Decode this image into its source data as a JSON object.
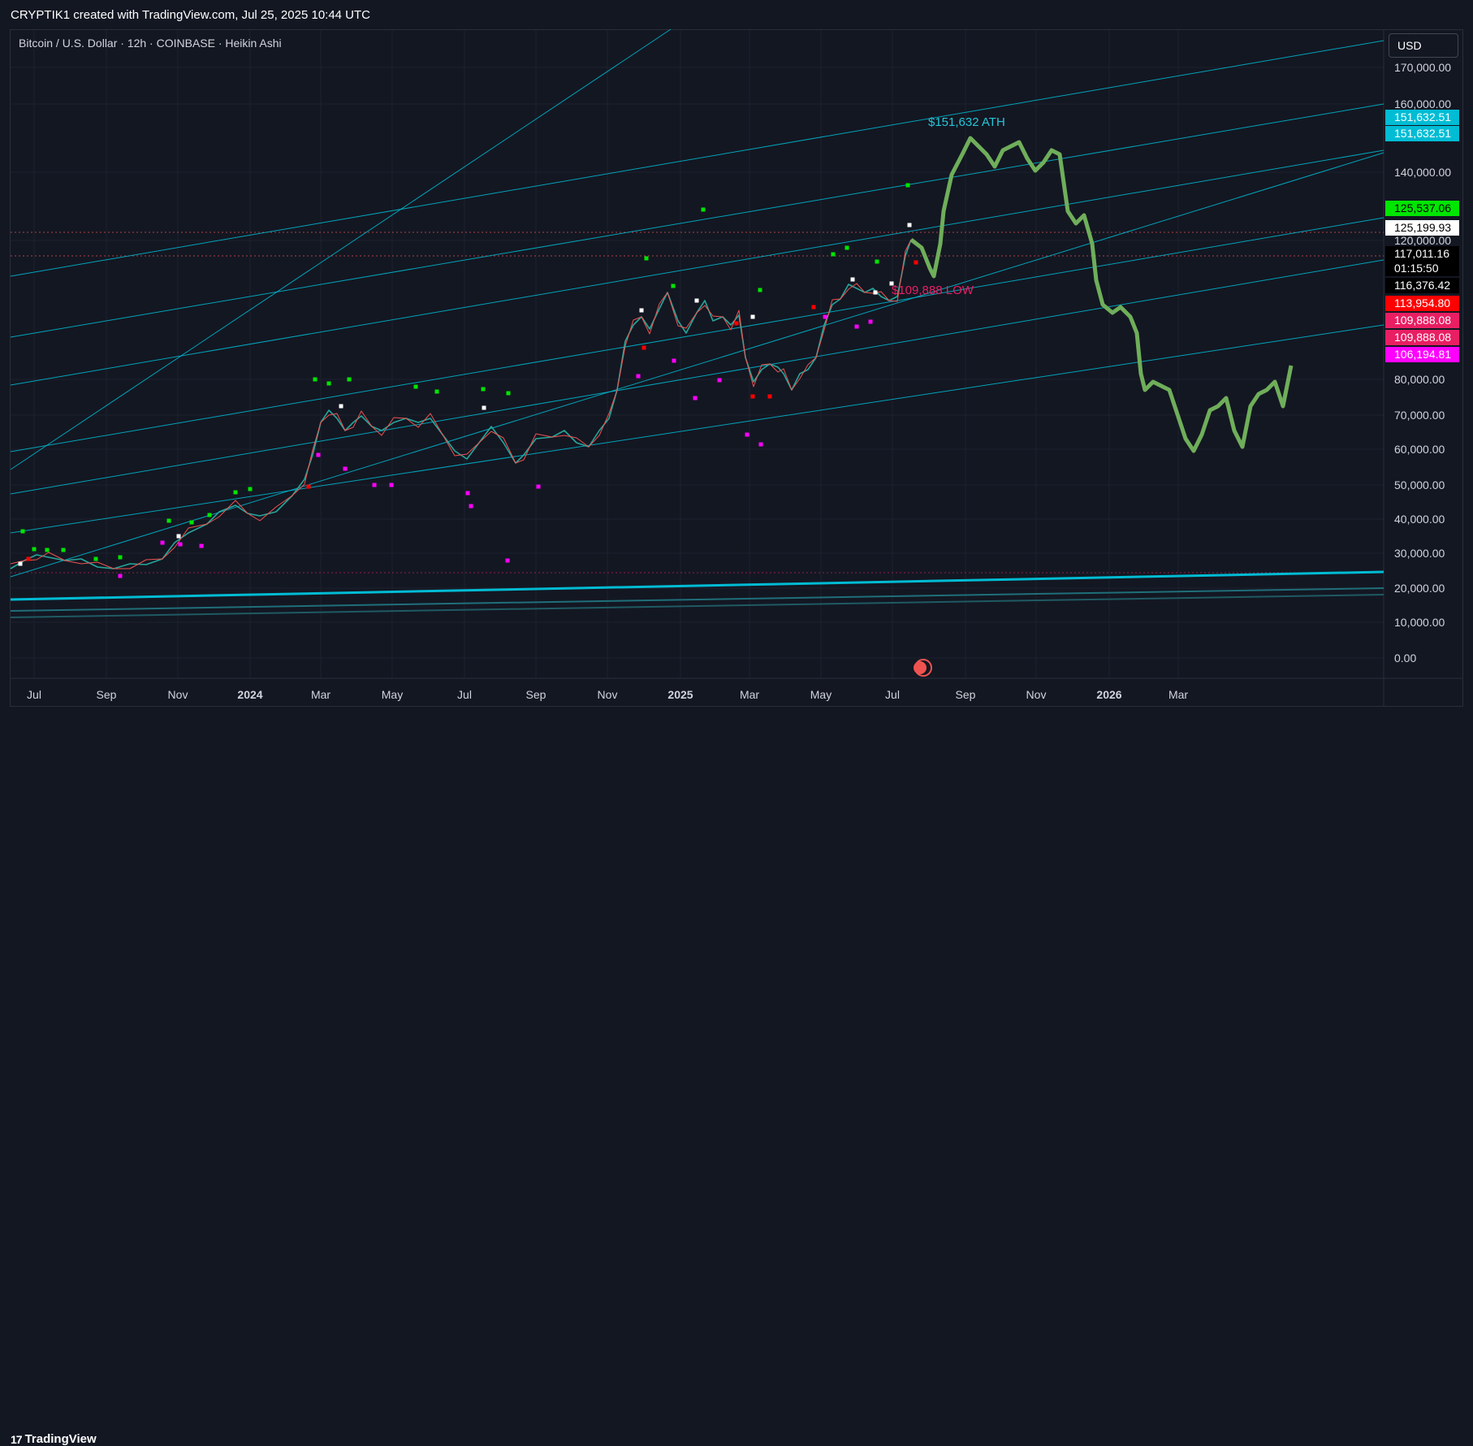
{
  "header": {
    "credit": "CRYPTIK1 created with TradingView.com, Jul 25, 2025 10:44 UTC"
  },
  "symbol": {
    "title": "Bitcoin / U.S. Dollar · 12h · COINBASE · Heikin Ashi"
  },
  "currency": {
    "label": "USD"
  },
  "annotations": {
    "ath": "$151,632 ATH",
    "low": "$109,888 LOW"
  },
  "price_axis": {
    "ticks": [
      "170,000.00",
      "160,000.00",
      "140,000.00",
      "120,000.00",
      "80,000.00",
      "70,000.00",
      "60,000.00",
      "50,000.00",
      "40,000.00",
      "30,000.00",
      "20,000.00",
      "10,000.00",
      "0.00"
    ]
  },
  "price_labels": [
    {
      "text": "151,632.51",
      "bg": "#00bcd4",
      "fg": "#ffffff"
    },
    {
      "text": "151,632.51",
      "bg": "#00bcd4",
      "fg": "#ffffff"
    },
    {
      "text": "125,537.06",
      "bg": "#00e600",
      "fg": "#000000"
    },
    {
      "text": "125,199.93",
      "bg": "#ffffff",
      "fg": "#000000"
    },
    {
      "text": "117,011.16",
      "bg": "#000000",
      "fg": "#ffffff"
    },
    {
      "text": "01:15:50",
      "bg": "#000000",
      "fg": "#ffffff"
    },
    {
      "text": "116,376.42",
      "bg": "#000000",
      "fg": "#ffffff"
    },
    {
      "text": "113,954.80",
      "bg": "#ff0000",
      "fg": "#ffffff"
    },
    {
      "text": "109,888.08",
      "bg": "#e91e63",
      "fg": "#ffffff"
    },
    {
      "text": "109,888.08",
      "bg": "#e91e63",
      "fg": "#ffffff"
    },
    {
      "text": "106,194.81",
      "bg": "#ff00ff",
      "fg": "#ffffff"
    }
  ],
  "time_axis": {
    "ticks": [
      {
        "label": "Jul",
        "bold": false
      },
      {
        "label": "Sep",
        "bold": false
      },
      {
        "label": "Nov",
        "bold": false
      },
      {
        "label": "2024",
        "bold": true
      },
      {
        "label": "Mar",
        "bold": false
      },
      {
        "label": "May",
        "bold": false
      },
      {
        "label": "Jul",
        "bold": false
      },
      {
        "label": "Sep",
        "bold": false
      },
      {
        "label": "Nov",
        "bold": false
      },
      {
        "label": "2025",
        "bold": true
      },
      {
        "label": "Mar",
        "bold": false
      },
      {
        "label": "May",
        "bold": false
      },
      {
        "label": "Jul",
        "bold": false
      },
      {
        "label": "Sep",
        "bold": false
      },
      {
        "label": "Nov",
        "bold": false
      },
      {
        "label": "2026",
        "bold": true
      },
      {
        "label": "Mar",
        "bold": false
      }
    ]
  },
  "footer": {
    "brand": "TradingView"
  },
  "colors": {
    "background": "#131722",
    "grid": "#1e222d",
    "trendline": "#00bcd4",
    "candle_up": "#26a69a",
    "candle_down": "#ef5350",
    "projection": "#6fae5a",
    "ath_text": "#26c6da",
    "low_text": "#e91e63"
  },
  "icons": {
    "event": "us-flag-event-icon",
    "brand": "tradingview-logo-icon"
  }
}
